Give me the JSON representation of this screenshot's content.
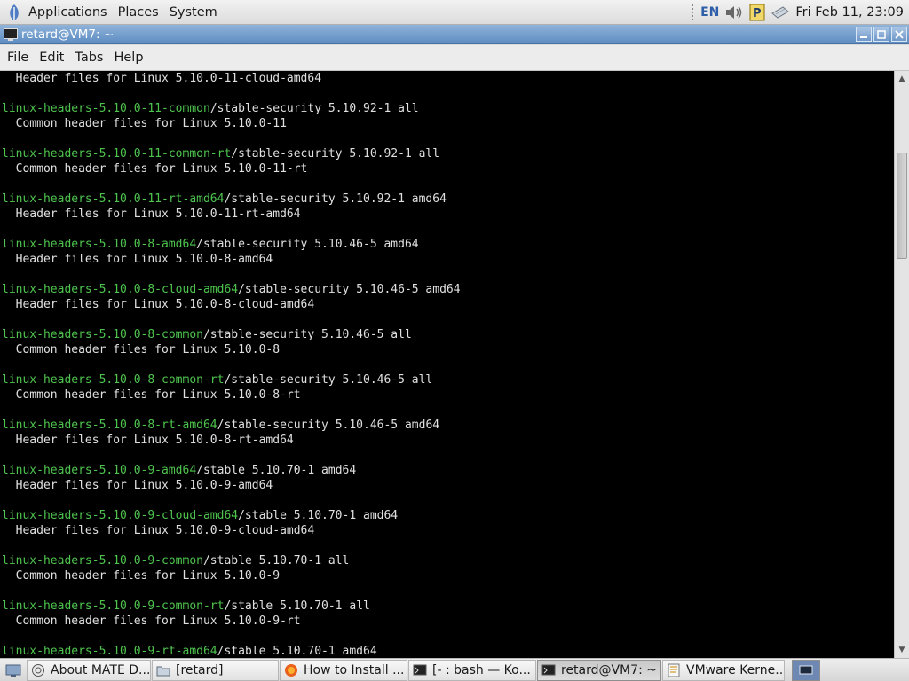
{
  "top_panel": {
    "menus": [
      "Applications",
      "Places",
      "System"
    ],
    "keyboard_layout": "EN",
    "clock": "Fri Feb 11, 23:09"
  },
  "window": {
    "title": "retard@VM7: ~",
    "menu": [
      "File",
      "Edit",
      "Tabs",
      "Help"
    ]
  },
  "terminal": {
    "colors": {
      "background": "#000000",
      "text": "#e0e0e0",
      "package": "#4ec44e"
    },
    "lines": [
      {
        "pkg": "",
        "rest": "  Header files for Linux 5.10.0-11-cloud-amd64"
      },
      {
        "pkg": "",
        "rest": ""
      },
      {
        "pkg": "linux-headers-5.10.0-11-common",
        "rest": "/stable-security 5.10.92-1 all"
      },
      {
        "pkg": "",
        "rest": "  Common header files for Linux 5.10.0-11"
      },
      {
        "pkg": "",
        "rest": ""
      },
      {
        "pkg": "linux-headers-5.10.0-11-common-rt",
        "rest": "/stable-security 5.10.92-1 all"
      },
      {
        "pkg": "",
        "rest": "  Common header files for Linux 5.10.0-11-rt"
      },
      {
        "pkg": "",
        "rest": ""
      },
      {
        "pkg": "linux-headers-5.10.0-11-rt-amd64",
        "rest": "/stable-security 5.10.92-1 amd64"
      },
      {
        "pkg": "",
        "rest": "  Header files for Linux 5.10.0-11-rt-amd64"
      },
      {
        "pkg": "",
        "rest": ""
      },
      {
        "pkg": "linux-headers-5.10.0-8-amd64",
        "rest": "/stable-security 5.10.46-5 amd64"
      },
      {
        "pkg": "",
        "rest": "  Header files for Linux 5.10.0-8-amd64"
      },
      {
        "pkg": "",
        "rest": ""
      },
      {
        "pkg": "linux-headers-5.10.0-8-cloud-amd64",
        "rest": "/stable-security 5.10.46-5 amd64"
      },
      {
        "pkg": "",
        "rest": "  Header files for Linux 5.10.0-8-cloud-amd64"
      },
      {
        "pkg": "",
        "rest": ""
      },
      {
        "pkg": "linux-headers-5.10.0-8-common",
        "rest": "/stable-security 5.10.46-5 all"
      },
      {
        "pkg": "",
        "rest": "  Common header files for Linux 5.10.0-8"
      },
      {
        "pkg": "",
        "rest": ""
      },
      {
        "pkg": "linux-headers-5.10.0-8-common-rt",
        "rest": "/stable-security 5.10.46-5 all"
      },
      {
        "pkg": "",
        "rest": "  Common header files for Linux 5.10.0-8-rt"
      },
      {
        "pkg": "",
        "rest": ""
      },
      {
        "pkg": "linux-headers-5.10.0-8-rt-amd64",
        "rest": "/stable-security 5.10.46-5 amd64"
      },
      {
        "pkg": "",
        "rest": "  Header files for Linux 5.10.0-8-rt-amd64"
      },
      {
        "pkg": "",
        "rest": ""
      },
      {
        "pkg": "linux-headers-5.10.0-9-amd64",
        "rest": "/stable 5.10.70-1 amd64"
      },
      {
        "pkg": "",
        "rest": "  Header files for Linux 5.10.0-9-amd64"
      },
      {
        "pkg": "",
        "rest": ""
      },
      {
        "pkg": "linux-headers-5.10.0-9-cloud-amd64",
        "rest": "/stable 5.10.70-1 amd64"
      },
      {
        "pkg": "",
        "rest": "  Header files for Linux 5.10.0-9-cloud-amd64"
      },
      {
        "pkg": "",
        "rest": ""
      },
      {
        "pkg": "linux-headers-5.10.0-9-common",
        "rest": "/stable 5.10.70-1 all"
      },
      {
        "pkg": "",
        "rest": "  Common header files for Linux 5.10.0-9"
      },
      {
        "pkg": "",
        "rest": ""
      },
      {
        "pkg": "linux-headers-5.10.0-9-common-rt",
        "rest": "/stable 5.10.70-1 all"
      },
      {
        "pkg": "",
        "rest": "  Common header files for Linux 5.10.0-9-rt"
      },
      {
        "pkg": "",
        "rest": ""
      },
      {
        "pkg": "linux-headers-5.10.0-9-rt-amd64",
        "rest": "/stable 5.10.70-1 amd64"
      }
    ]
  },
  "taskbar": {
    "tasks": [
      {
        "label": "About MATE D...",
        "icon": "mate-about-icon",
        "active": false
      },
      {
        "label": "[retard]",
        "icon": "folder-icon",
        "active": false
      },
      {
        "label": "How to Install ...",
        "icon": "firefox-icon",
        "active": false
      },
      {
        "label": "[- : bash — Ko...",
        "icon": "terminal-icon",
        "active": false
      },
      {
        "label": "retard@VM7: ~",
        "icon": "terminal-icon",
        "active": true
      },
      {
        "label": "VMware Kerne...",
        "icon": "text-editor-icon",
        "active": false
      }
    ]
  }
}
